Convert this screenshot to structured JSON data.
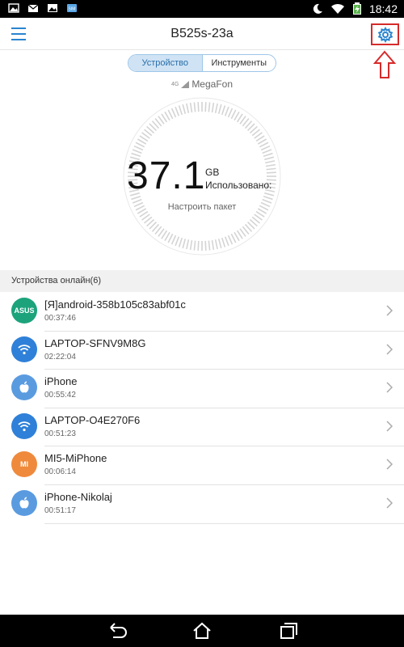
{
  "status_bar": {
    "time": "18:42",
    "icons": [
      "gallery-icon",
      "mail-icon",
      "image-icon",
      "sim-icon",
      "moon-icon",
      "wifi-icon",
      "battery-charging-icon"
    ]
  },
  "app_bar": {
    "title": "B525s-23a",
    "menu_icon": "hamburger-menu-icon",
    "settings_icon": "gear-icon"
  },
  "tabs": [
    {
      "label": "Устройство",
      "active": true
    },
    {
      "label": "Инструменты",
      "active": false
    }
  ],
  "operator": {
    "network": "4G",
    "name": "MegaFon"
  },
  "usage": {
    "value": "37.1",
    "unit": "GB",
    "label": "Использовано:",
    "configure_label": "Настроить пакет"
  },
  "devices_section": {
    "title": "Устройства онлайн(6)"
  },
  "devices": [
    {
      "name": "[Я]android-358b105c83abf01c",
      "time": "00:37:46",
      "icon": "asus-icon",
      "icon_text": "ASUS",
      "color": "#1ca37c"
    },
    {
      "name": "LAPTOP-SFNV9M8G",
      "time": "02:22:04",
      "icon": "wifi-icon",
      "icon_text": "",
      "color": "#2f80d8"
    },
    {
      "name": "iPhone",
      "time": "00:55:42",
      "icon": "apple-icon",
      "icon_text": "",
      "color": "#5a9be0"
    },
    {
      "name": "LAPTOP-O4E270F6",
      "time": "00:51:23",
      "icon": "wifi-icon",
      "icon_text": "",
      "color": "#2f80d8"
    },
    {
      "name": "MI5-MiPhone",
      "time": "00:06:14",
      "icon": "xiaomi-icon",
      "icon_text": "MI",
      "color": "#ef8a3c"
    },
    {
      "name": "iPhone-Nikolaj",
      "time": "00:51:17",
      "icon": "apple-icon",
      "icon_text": "",
      "color": "#5a9be0"
    }
  ],
  "colors": {
    "accent": "#2a84cf",
    "highlight_border": "#d62b2b"
  }
}
